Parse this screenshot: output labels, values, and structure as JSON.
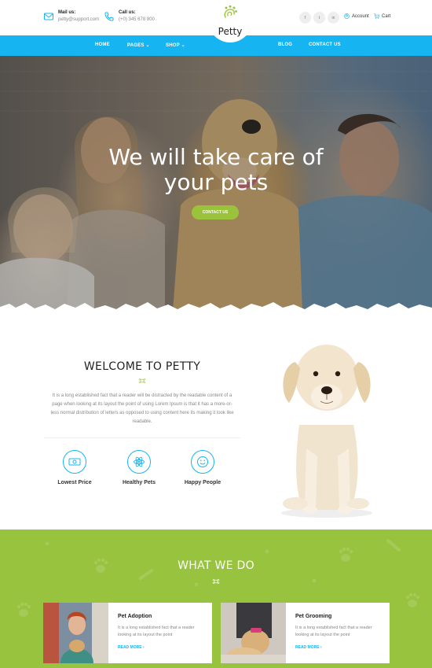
{
  "header": {
    "mail_label": "Mail us:",
    "mail_value": "petty@support.com",
    "call_label": "Call us:",
    "call_value": "(+0) 345 678 800",
    "brand_name": "Petty",
    "socials": [
      "f",
      "t",
      "in"
    ],
    "account_label": "Account",
    "cart_label": "Cart"
  },
  "nav": {
    "home": "HOME",
    "pages": "PAGES",
    "shop": "SHOP",
    "blog": "BLOG",
    "contact": "CONTACT US"
  },
  "hero": {
    "title_line1": "We will take care of",
    "title_line2": "your pets",
    "cta_label": "CONTACT US"
  },
  "welcome": {
    "title": "WELCOME TO PETTY",
    "text": "It is a long established fact that a reader will be distracted by the readable content of a page when looking at its layout the point of using Lorem Ipsum is that it has a more-or-less normal distribution of letters as opposed to using content here its making it look like readable.",
    "features": [
      {
        "label": "Lowest Price",
        "icon": "money-icon"
      },
      {
        "label": "Healthy Pets",
        "icon": "atom-icon"
      },
      {
        "label": "Happy People",
        "icon": "smile-icon"
      }
    ]
  },
  "services": {
    "title": "WHAT WE DO",
    "cards": [
      {
        "title": "Pet Adoption",
        "text": "It is a long established fact that a reader looking at its layout the point",
        "link": "READ MORE"
      },
      {
        "title": "Pet Grooming",
        "text": "It is a long established fact that a reader looking at its layout the point",
        "link": "READ MORE"
      }
    ]
  },
  "colors": {
    "accent_blue": "#16b4f0",
    "accent_green": "#9bc23b"
  }
}
